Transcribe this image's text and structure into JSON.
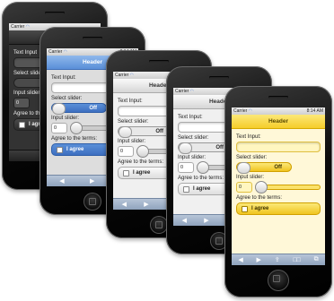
{
  "status": {
    "carrier": "Carrier",
    "time": "8:14 AM"
  },
  "header": {
    "title": "Header"
  },
  "form": {
    "text_input_label": "Text Input:",
    "text_input_label_back": "Text Input",
    "select_slider_label": "Select slider:",
    "select_slider_label_back": "Select slider",
    "select_slider_value": "Off",
    "input_slider_label": "Input slider:",
    "input_slider_value": "0",
    "agree_label": "Agree to the terms:",
    "agree_checkbox": "I agree"
  },
  "toolbar": {
    "back": "◀",
    "forward": "▶",
    "share": "⇪",
    "bookmarks": "□□",
    "tabs": "⧉"
  },
  "themes": {
    "dark": "#2a2a2a",
    "blue": "#5a8fd8",
    "grey": "#d6d6d6",
    "yellow": "#f5cd2a"
  }
}
